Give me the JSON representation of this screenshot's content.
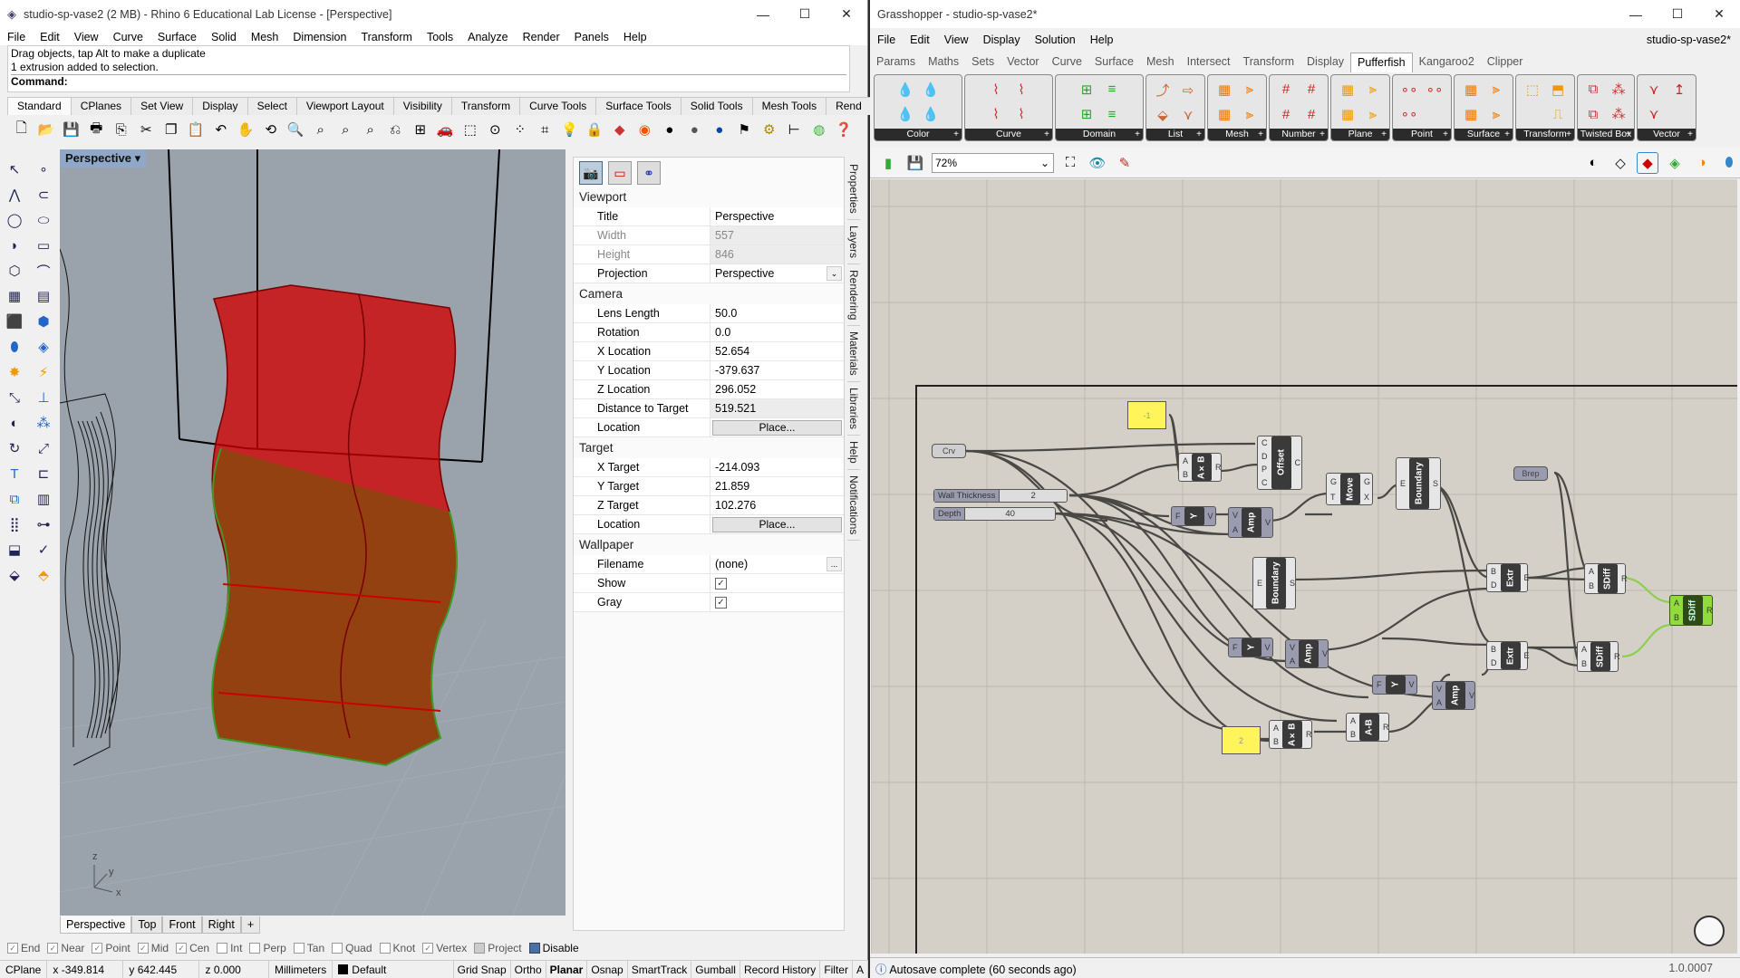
{
  "rhino": {
    "title": "studio-sp-vase2 (2 MB) - Rhino 6 Educational Lab License - [Perspective]",
    "menu": [
      "File",
      "Edit",
      "View",
      "Curve",
      "Surface",
      "Solid",
      "Mesh",
      "Dimension",
      "Transform",
      "Tools",
      "Analyze",
      "Render",
      "Panels",
      "Help"
    ],
    "command_history": [
      "Drag objects, tap Alt to make a duplicate",
      "1 extrusion added to selection."
    ],
    "command_prompt": "Command:",
    "toolbar_tabs": [
      "Standard",
      "CPlanes",
      "Set View",
      "Display",
      "Select",
      "Viewport Layout",
      "Visibility",
      "Transform",
      "Curve Tools",
      "Surface Tools",
      "Solid Tools",
      "Mesh Tools",
      "Rend"
    ],
    "toolbar_overflow": "»",
    "viewport_label": "Perspective",
    "viewport_tabs": [
      "Perspective",
      "Top",
      "Front",
      "Right"
    ],
    "viewport_tab_add": "+",
    "axis_labels": {
      "z": "z",
      "y": "y",
      "x": "x"
    },
    "properties": {
      "sections": [
        {
          "title": "Viewport",
          "rows": [
            {
              "label": "Title",
              "value": "Perspective"
            },
            {
              "label": "Width",
              "value": "557",
              "disabled": true
            },
            {
              "label": "Height",
              "value": "846",
              "disabled": true
            },
            {
              "label": "Projection",
              "value": "Perspective",
              "dropdown": true
            }
          ]
        },
        {
          "title": "Camera",
          "rows": [
            {
              "label": "Lens Length",
              "value": "50.0"
            },
            {
              "label": "Rotation",
              "value": "0.0"
            },
            {
              "label": "X Location",
              "value": "52.654"
            },
            {
              "label": "Y Location",
              "value": "-379.637"
            },
            {
              "label": "Z Location",
              "value": "296.052"
            },
            {
              "label": "Distance to Target",
              "value": "519.521",
              "readonly": true
            },
            {
              "label": "Location",
              "button": "Place..."
            }
          ]
        },
        {
          "title": "Target",
          "rows": [
            {
              "label": "X Target",
              "value": "-214.093"
            },
            {
              "label": "Y Target",
              "value": "21.859"
            },
            {
              "label": "Z Target",
              "value": "102.276"
            },
            {
              "label": "Location",
              "button": "Place..."
            }
          ]
        },
        {
          "title": "Wallpaper",
          "rows": [
            {
              "label": "Filename",
              "value": "(none)",
              "browse": "..."
            },
            {
              "label": "Show",
              "checkbox": true
            },
            {
              "label": "Gray",
              "checkbox": true
            }
          ]
        }
      ]
    },
    "side_tabs": [
      "Properties",
      "Layers",
      "Rendering",
      "Materials",
      "Libraries",
      "Help",
      "Notifications"
    ],
    "osnaps": [
      {
        "label": "End",
        "checked": true
      },
      {
        "label": "Near",
        "checked": true
      },
      {
        "label": "Point",
        "checked": true
      },
      {
        "label": "Mid",
        "checked": true
      },
      {
        "label": "Cen",
        "checked": true
      },
      {
        "label": "Int",
        "checked": false
      },
      {
        "label": "Perp",
        "checked": false
      },
      {
        "label": "Tan",
        "checked": false
      },
      {
        "label": "Quad",
        "checked": false
      },
      {
        "label": "Knot",
        "checked": false
      },
      {
        "label": "Vertex",
        "checked": true
      },
      {
        "label": "Project",
        "checked": false
      },
      {
        "label": "Disable",
        "checked": false
      }
    ],
    "status": {
      "cplane": "CPlane",
      "x": "x -349.814",
      "y": "y 642.445",
      "z": "z 0.000",
      "units": "Millimeters",
      "layer": "Default",
      "toggles": [
        "Grid Snap",
        "Ortho",
        "Planar",
        "Osnap",
        "SmartTrack",
        "Gumball",
        "Record History",
        "Filter",
        "A"
      ],
      "active_toggle": "Planar"
    }
  },
  "grasshopper": {
    "title": "Grasshopper - studio-sp-vase2*",
    "doc_name": "studio-sp-vase2*",
    "menu": [
      "File",
      "Edit",
      "View",
      "Display",
      "Solution",
      "Help"
    ],
    "tabs": [
      "Params",
      "Maths",
      "Sets",
      "Vector",
      "Curve",
      "Surface",
      "Mesh",
      "Intersect",
      "Transform",
      "Display",
      "Pufferfish",
      "Kangaroo2",
      "Clipper"
    ],
    "active_tab": "Pufferfish",
    "ribbon_groups": [
      "Color",
      "Curve",
      "Domain",
      "List",
      "Mesh",
      "Number",
      "Plane",
      "Point",
      "Surface",
      "Transform",
      "Twisted Box",
      "Vector"
    ],
    "zoom": "72%",
    "status": "Autosave complete (60 seconds ago)",
    "version": "1.0.0007",
    "nodes": {
      "panel_neg": "-1",
      "panel_two": "2",
      "crv": "Crv",
      "brep": "Brep",
      "slider_wall": {
        "name": "Wall Thickness",
        "value": "2"
      },
      "slider_depth": {
        "name": "Depth",
        "value": "40"
      },
      "mul1": {
        "name": "A×B",
        "in": [
          "A",
          "B"
        ],
        "out": [
          "R"
        ]
      },
      "offset": {
        "name": "Offset",
        "in": [
          "C",
          "D",
          "P",
          "C"
        ],
        "out": [
          "C"
        ]
      },
      "move": {
        "name": "Move",
        "in": [
          "G",
          "T"
        ],
        "out": [
          "G",
          "X"
        ]
      },
      "boundary1": {
        "name": "Boundary",
        "in": [
          "E"
        ],
        "out": [
          "S"
        ]
      },
      "boundary2": {
        "name": "Boundary",
        "in": [
          "E"
        ],
        "out": [
          "S"
        ]
      },
      "y1": {
        "name": "Y",
        "in": [
          "F"
        ],
        "out": [
          "V"
        ]
      },
      "amp1": {
        "name": "Amp",
        "in": [
          "V",
          "A"
        ],
        "out": [
          "V"
        ]
      },
      "y2": {
        "name": "Y",
        "in": [
          "F"
        ],
        "out": [
          "V"
        ]
      },
      "amp2": {
        "name": "Amp",
        "in": [
          "V",
          "A"
        ],
        "out": [
          "V"
        ]
      },
      "y3": {
        "name": "Y",
        "in": [
          "F"
        ],
        "out": [
          "V"
        ]
      },
      "amp3": {
        "name": "Amp",
        "in": [
          "V",
          "A"
        ],
        "out": [
          "V"
        ]
      },
      "extr1": {
        "name": "Extr",
        "in": [
          "B",
          "D"
        ],
        "out": [
          "E"
        ]
      },
      "extr2": {
        "name": "Extr",
        "in": [
          "B",
          "D"
        ],
        "out": [
          "E"
        ]
      },
      "sdiff1": {
        "name": "SDiff",
        "in": [
          "A",
          "B"
        ],
        "out": [
          "R"
        ]
      },
      "sdiff2": {
        "name": "SDiff",
        "in": [
          "A",
          "B"
        ],
        "out": [
          "R"
        ]
      },
      "sdiff3": {
        "name": "SDiff",
        "in": [
          "A",
          "B"
        ],
        "out": [
          "R"
        ]
      },
      "mul2": {
        "name": "A×B",
        "in": [
          "A",
          "B"
        ],
        "out": [
          "R"
        ]
      },
      "sub": {
        "name": "A-B",
        "in": [
          "A",
          "B"
        ],
        "out": [
          "R"
        ]
      }
    }
  }
}
